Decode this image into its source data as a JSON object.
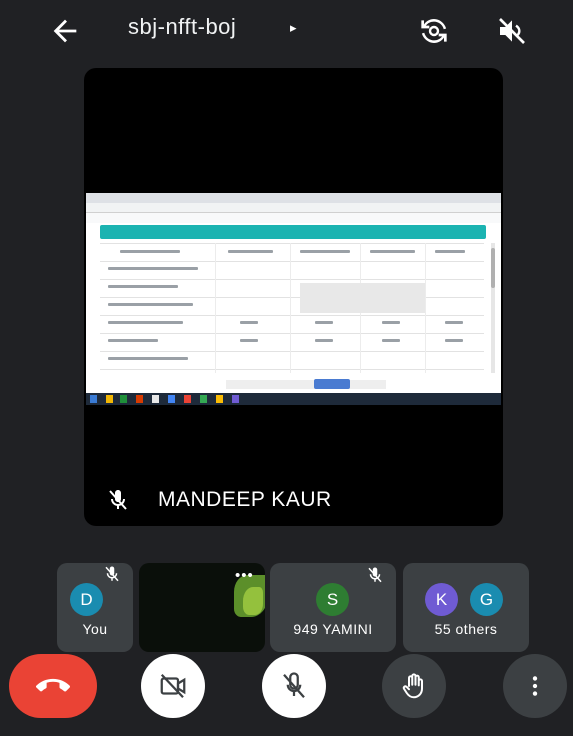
{
  "header": {
    "meeting_code": "sbj-nfft-boj",
    "caret": "▸",
    "back_icon": "arrow-left-icon",
    "switch_camera_icon": "camera-switch-icon",
    "speaker_icon": "speaker-off-icon"
  },
  "main_tile": {
    "presenter_name": "MANDEEP KAUR",
    "muted_icon": "mic-off-icon"
  },
  "participants": [
    {
      "label": "You",
      "initial": "D",
      "avatar_color": "#1a8cb0",
      "muted": true
    },
    {
      "label": "",
      "initial": "",
      "more": "•••",
      "video": true
    },
    {
      "label": "949 YAMINI",
      "initial": "S",
      "avatar_color": "#2e7d32",
      "muted": true
    },
    {
      "label": "55 others",
      "initials": [
        "K",
        "G"
      ],
      "avatar_colors": [
        "#6f5bd3",
        "#1a8cb0"
      ]
    }
  ],
  "controls": {
    "end_call_icon": "hang-up-icon",
    "camera_icon": "camera-off-icon",
    "mic_icon": "mic-off-icon",
    "hand_icon": "raise-hand-icon",
    "more_icon": "more-vertical-icon"
  },
  "colors": {
    "background": "#202124",
    "tile": "#3c4043",
    "end_call": "#ea4335",
    "portal_teal": "#1bb3b1"
  }
}
